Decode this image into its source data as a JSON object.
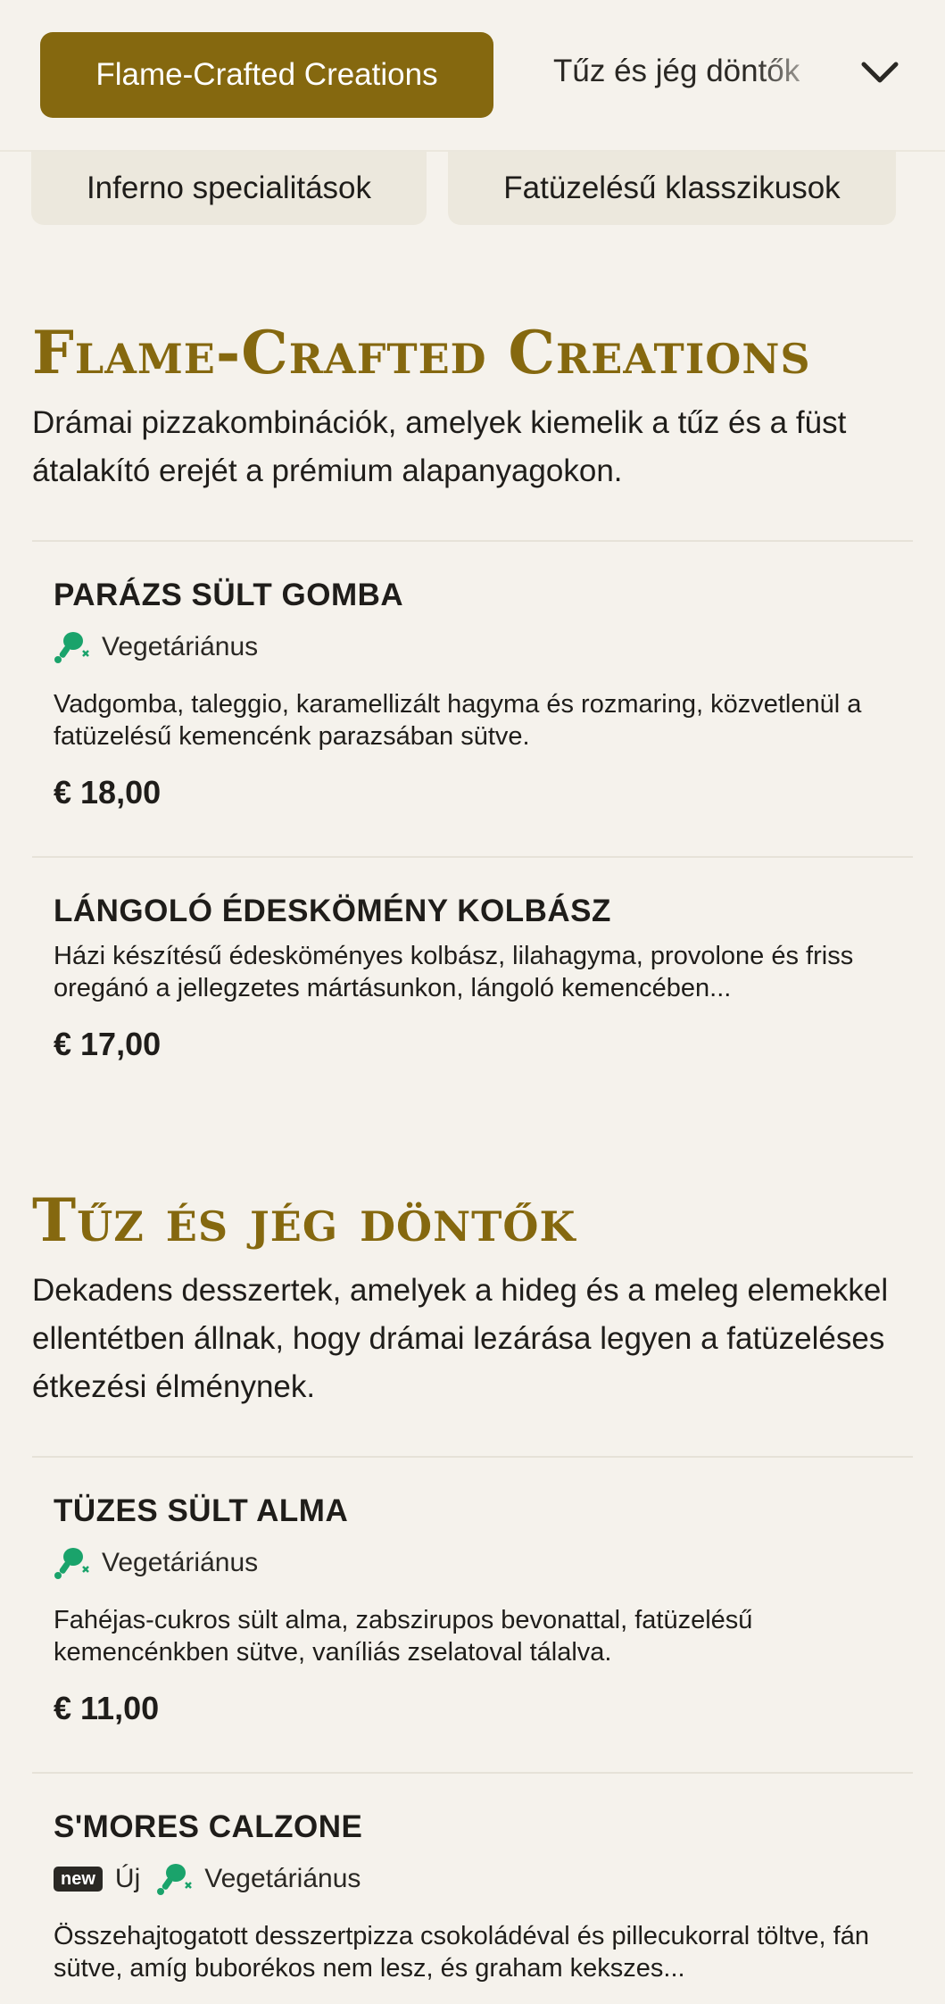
{
  "nav": {
    "active_category": "Flame-Crafted Creations",
    "next_category": "Tűz és jég döntők",
    "pills": [
      "Inferno specialitások",
      "Fatüzelésű klasszikusok"
    ]
  },
  "sections": [
    {
      "title": "Flame-Crafted Creations",
      "description": "Drámai pizzakombinációk, amelyek kiemelik a tűz és a füst átalakító erejét a prémium alapanyagokon.",
      "items": [
        {
          "name": "PARÁZS SÜLT GOMBA",
          "tag_veg": "Vegetáriánus",
          "description": "Vadgomba, taleggio, karamellizált hagyma és rozmaring, közvetlenül a fatüzelésű kemencénk parazsában sütve.",
          "price": "€ 18,00"
        },
        {
          "name": "LÁNGOLÓ ÉDESKÖMÉNY KOLBÁSZ",
          "description": "Házi készítésű édesköményes kolbász, lilahagyma, provolone és friss oregánó a jellegzetes mártásunkon, lángoló kemencében...",
          "price": "€ 17,00"
        }
      ]
    },
    {
      "title": "Tűz és jég döntők",
      "description": "Dekadens desszertek, amelyek a hideg és a meleg elemekkel ellentétben állnak, hogy drámai lezárása legyen a fatüzeléses étkezési élménynek.",
      "items": [
        {
          "name": "TÜZES SÜLT ALMA",
          "tag_veg": "Vegetáriánus",
          "description": "Fahéjas-cukros sült alma, zabszirupos bevonattal, fatüzelésű kemencénkben sütve, vaníliás zselatoval tálalva.",
          "price": "€ 11,00"
        },
        {
          "name": "S'MORES CALZONE",
          "badge_new": "new",
          "tag_new": "Új",
          "tag_veg": "Vegetáriánus",
          "description": "Összehajtogatott desszertpizza csokoládéval és pillecukorral töltve, fán sütve, amíg buborékos nem lesz, és graham kekszes..."
        }
      ]
    }
  ],
  "colors": {
    "accent": "#85680f",
    "background": "#f5f2ec",
    "pill_bg": "#ece8dd",
    "veg_icon": "#1aa36b",
    "text": "#1f1d1a"
  },
  "icons": {
    "veg": "vegetarian-drumstick-crossed-icon",
    "dropdown": "chevron-down-icon"
  }
}
